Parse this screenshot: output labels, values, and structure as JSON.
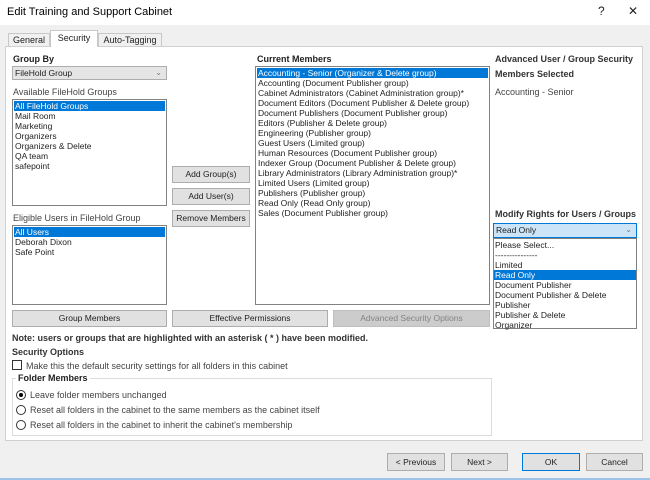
{
  "window": {
    "title": "Edit Training and Support Cabinet",
    "help": "?",
    "close": "✕"
  },
  "tabs": [
    {
      "label": "General"
    },
    {
      "label": "Security"
    },
    {
      "label": "Auto-Tagging"
    }
  ],
  "group_by": {
    "label": "Group By",
    "value": "FileHold Group"
  },
  "available_groups": {
    "label": "Available FileHold Groups",
    "items": [
      "All FileHold Groups",
      "Mail Room",
      "Marketing",
      "Organizers",
      "Organizers & Delete",
      "QA team",
      "safepoint"
    ]
  },
  "eligible_users": {
    "label": "Eligible Users in FileHold Group",
    "items": [
      "All Users",
      "Deborah Dixon",
      "Safe Point"
    ]
  },
  "middle_buttons": {
    "add_groups": "Add Group(s)",
    "add_users": "Add User(s)",
    "remove": "Remove Members"
  },
  "current_members": {
    "label": "Current Members",
    "items": [
      "Accounting - Senior (Organizer & Delete group)",
      "Accounting (Document Publisher group)",
      "Cabinet Administrators (Cabinet Administration group)*",
      "Document Editors (Document Publisher & Delete group)",
      "Document Publishers (Document Publisher group)",
      "Editors (Publisher & Delete group)",
      "Engineering (Publisher group)",
      "Guest Users (Limited group)",
      "Human Resources (Document Publisher group)",
      "Indexer Group (Document Publisher & Delete group)",
      "Library Administrators (Library Administration group)*",
      "Limited Users (Limited group)",
      "Publishers (Publisher group)",
      "Read Only (Read Only group)",
      "Sales (Document Publisher group)"
    ]
  },
  "advanced": {
    "title": "Advanced User / Group Security",
    "members_selected_label": "Members Selected",
    "members_selected": "Accounting - Senior"
  },
  "modify_rights": {
    "label": "Modify Rights for Users / Groups",
    "value": "Read Only",
    "options": [
      "Please Select...",
      "---------------",
      "Limited",
      "Read Only",
      "Document Publisher",
      "Document Publisher & Delete",
      "Publisher",
      "Publisher & Delete",
      "Organizer"
    ]
  },
  "row_buttons": {
    "group_members": "Group Members",
    "effective_permissions": "Effective Permissions",
    "advanced_options": "Advanced Security Options"
  },
  "note": "Note: users or groups that are highlighted with an asterisk ( * ) have been modified.",
  "security_options": {
    "label": "Security Options",
    "checkbox": "Make this the default security settings for all folders in this cabinet"
  },
  "folder_members": {
    "label": "Folder Members",
    "options": [
      "Leave folder members unchanged",
      "Reset all folders in the cabinet to the same members as the cabinet itself",
      "Reset all folders in the cabinet to inherit the cabinet's membership"
    ]
  },
  "footer": {
    "previous": "< Previous",
    "next": "Next >",
    "ok": "OK",
    "cancel": "Cancel"
  }
}
